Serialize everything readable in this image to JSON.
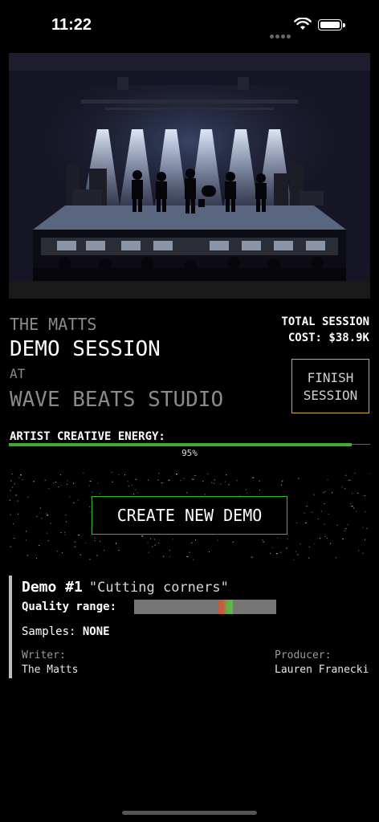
{
  "status_bar": {
    "time": "11:22"
  },
  "session": {
    "artist": "THE MATTS",
    "title": "DEMO SESSION",
    "at_label": "AT",
    "studio": "WAVE BEATS STUDIO",
    "total_cost_line1": "TOTAL SESSION",
    "total_cost_line2": "COST: $38.9K",
    "finish_line1": "FINISH",
    "finish_line2": "SESSION"
  },
  "energy": {
    "label": "ARTIST CREATIVE ENERGY:",
    "percent_text": "95%",
    "fraction": 0.95,
    "bar_color": "#3fae2f"
  },
  "create_button": {
    "label": "CREATE NEW DEMO",
    "border_color": "#36b52f"
  },
  "demo": {
    "number": "Demo #1",
    "name": "\"Cutting corners\"",
    "quality_label": "Quality range:",
    "samples_label": "Samples:",
    "samples_value": "NONE",
    "writer_label": "Writer:",
    "writer_value": "The Matts",
    "producer_label": "Producer:",
    "producer_value": "Lauren Franecki"
  },
  "colors": {
    "accent_gold": "#d4a74a",
    "accent_green": "#36b52f"
  },
  "hero": {
    "icon": "concert-stage-image"
  }
}
